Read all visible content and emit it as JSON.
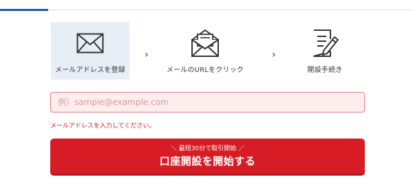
{
  "steps": [
    {
      "label": "メールアドレスを登録",
      "icon": "envelope-icon",
      "active": true
    },
    {
      "label": "メールのURLをクリック",
      "icon": "open-envelope-icon",
      "active": false
    },
    {
      "label": "開設手続き",
      "icon": "document-pen-icon",
      "active": false
    }
  ],
  "step_separator": "›",
  "email": {
    "value": "",
    "placeholder": "例）sample@example.com"
  },
  "error": "メールアドレスを入力してください。",
  "cta": {
    "sub": "＼ 最短30分で取引開始 ／",
    "main": "口座開設を開始する"
  },
  "colors": {
    "accent": "#1a5aa6",
    "cta": "#d71c25",
    "error": "#d0202a",
    "field_bg": "#fdeeee",
    "active_step_bg": "#e8eef5"
  }
}
